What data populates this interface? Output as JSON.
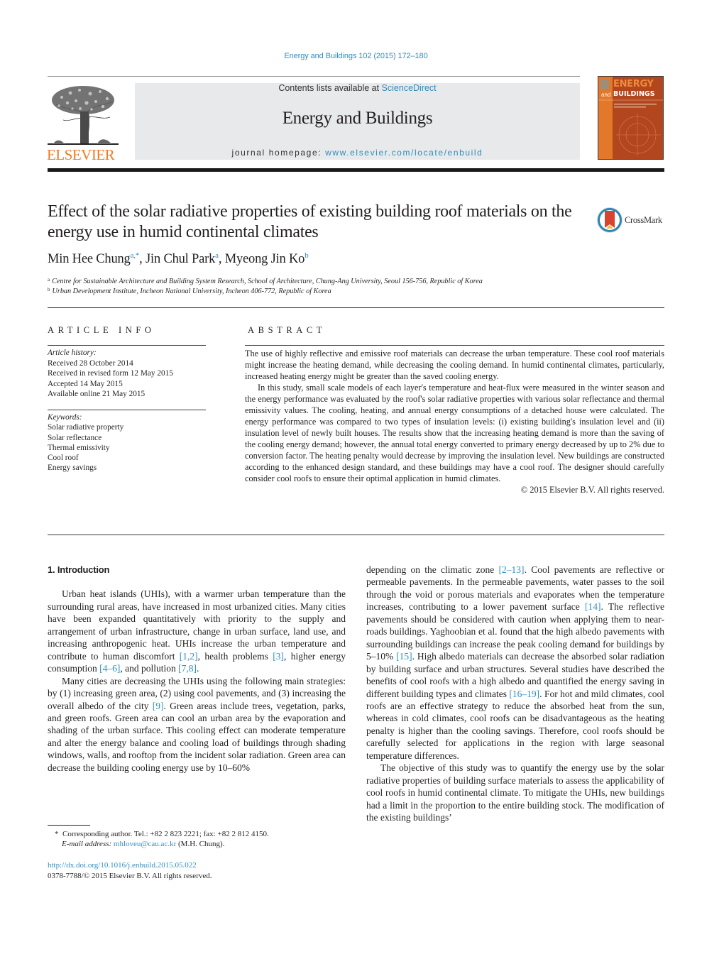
{
  "header": {
    "citation": "Energy and Buildings 102 (2015) 172–180",
    "publisher_logo_text": "ELSEVIER",
    "contents_prefix": "Contents lists available at ",
    "contents_link": "ScienceDirect",
    "journal_name": "Energy and Buildings",
    "homepage_prefix": "journal homepage: ",
    "homepage_link": "www.elsevier.com/locate/enbuild",
    "cover": {
      "line1": "ENERGY",
      "line2_small": "and",
      "line2": "BUILDINGS"
    },
    "colors": {
      "link": "#2e8fc0",
      "elsevier_orange": "#f07a22",
      "cover_dark": "#b2461f",
      "cover_light": "#e3782a"
    }
  },
  "article": {
    "title": "Effect of the solar radiative properties of existing building roof materials on the energy use in humid continental climates",
    "crossmark_label": "CrossMark",
    "authors": [
      {
        "name": "Min Hee Chung",
        "sup": "a,*"
      },
      {
        "name": "Jin Chul Park",
        "sup": "a"
      },
      {
        "name": "Myeong Jin Ko",
        "sup": "b"
      }
    ],
    "affiliations": [
      {
        "mark": "a",
        "text": "Centre for Sustainable Architecture and Building System Research, School of Architecture, Chung-Ang University, Seoul 156-756, Republic of Korea"
      },
      {
        "mark": "b",
        "text": "Urban Development Institute, Incheon National University, Incheon 406-772, Republic of Korea"
      }
    ]
  },
  "article_info": {
    "heading": "ARTICLE INFO",
    "history_label": "Article history:",
    "history": [
      "Received 28 October 2014",
      "Received in revised form 12 May 2015",
      "Accepted 14 May 2015",
      "Available online 21 May 2015"
    ],
    "keywords_label": "Keywords:",
    "keywords": [
      "Solar radiative property",
      "Solar reflectance",
      "Thermal emissivity",
      "Cool roof",
      "Energy savings"
    ]
  },
  "abstract": {
    "heading": "ABSTRACT",
    "paragraphs": [
      "The use of highly reflective and emissive roof materials can decrease the urban temperature. These cool roof materials might increase the heating demand, while decreasing the cooling demand. In humid continental climates, particularly, increased heating energy might be greater than the saved cooling energy.",
      "In this study, small scale models of each layer's temperature and heat-flux were measured in the winter season and the energy performance was evaluated by the roof's solar radiative properties with various solar reflectance and thermal emissivity values. The cooling, heating, and annual energy consumptions of a detached house were calculated. The energy performance was compared to two types of insulation levels: (i) existing building's insulation level and (ii) insulation level of newly built houses. The results show that the increasing heating demand is more than the saving of the cooling energy demand; however, the annual total energy converted to primary energy decreased by up to 2% due to conversion factor. The heating penalty would decrease by improving the insulation level. New buildings are constructed according to the enhanced design standard, and these buildings may have a cool roof. The designer should carefully consider cool roofs to ensure their optimal application in humid climates."
    ],
    "copyright": "© 2015 Elsevier B.V. All rights reserved."
  },
  "body": {
    "section_heading": "1.  Introduction",
    "left": [
      [
        {
          "t": "Urban heat islands (UHIs), with a warmer urban temperature than the surrounding rural areas, have increased in most urbanized cities. Many cities have been expanded quantitatively with priority to the supply and arrangement of urban infrastructure, change in urban surface, land use, and increasing anthropogenic heat. UHIs increase the urban temperature and contribute to human discomfort "
        },
        {
          "ref": "[1,2]"
        },
        {
          "t": ", health problems "
        },
        {
          "ref": "[3]"
        },
        {
          "t": ", higher energy consumption "
        },
        {
          "ref": "[4–6]"
        },
        {
          "t": ", and pollution "
        },
        {
          "ref": "[7,8]"
        },
        {
          "t": "."
        }
      ],
      [
        {
          "t": "Many cities are decreasing the UHIs using the following main strategies: by (1) increasing green area, (2) using cool pavements, and (3) increasing the overall albedo of the city "
        },
        {
          "ref": "[9]"
        },
        {
          "t": ". Green areas include trees, vegetation, parks, and green roofs. Green area can cool an urban area by the evaporation and shading of the urban surface. This cooling effect can moderate temperature and alter the energy balance and cooling load of buildings through shading windows, walls, and rooftop from the incident solar radiation. Green area can decrease the building cooling energy use by 10–60%"
        }
      ]
    ],
    "right": [
      [
        {
          "t": "depending on the climatic zone "
        },
        {
          "ref": "[2–13]"
        },
        {
          "t": ". Cool pavements are reflective or permeable pavements. In the permeable pavements, water passes to the soil through the void or porous materials and evaporates when the temperature increases, contributing to a lower pavement surface "
        },
        {
          "ref": "[14]"
        },
        {
          "t": ". The reflective pavements should be considered with caution when applying them to near-roads buildings. Yaghoobian et al. found that the high albedo pavements with surrounding buildings can increase the peak cooling demand for buildings by 5–10% "
        },
        {
          "ref": "[15]"
        },
        {
          "t": ". High albedo materials can decrease the absorbed solar radiation by building surface and urban structures. Several studies have described the benefits of cool roofs with a high albedo and quantified the energy saving in different building types and climates "
        },
        {
          "ref": "[16–19]"
        },
        {
          "t": ". For hot and mild climates, cool roofs are an effective strategy to reduce the absorbed heat from the sun, whereas in cold climates, cool roofs can be disadvantageous as the heating penalty is higher than the cooling savings. Therefore, cool roofs should be carefully selected for applications in the region with large seasonal temperature differences."
        }
      ],
      [
        {
          "t": "The objective of this study was to quantify the energy use by the solar radiative properties of building surface materials to assess the applicability of cool roofs in humid continental climate. To mitigate the UHIs, new buildings had a limit in the proportion to the entire building stock. The modification of the existing buildings’"
        }
      ]
    ]
  },
  "footnote": {
    "mark": "*",
    "text": "Corresponding author. Tel.: +82 2 823 2221; fax: +82 2 812 4150.",
    "email_label": "E-mail address: ",
    "email": "mhloveu@cau.ac.kr",
    "email_suffix": " (M.H. Chung)."
  },
  "doi": {
    "url": "http://dx.doi.org/10.1016/j.enbuild.2015.05.022",
    "issn_line": "0378-7788/© 2015 Elsevier B.V. All rights reserved."
  }
}
